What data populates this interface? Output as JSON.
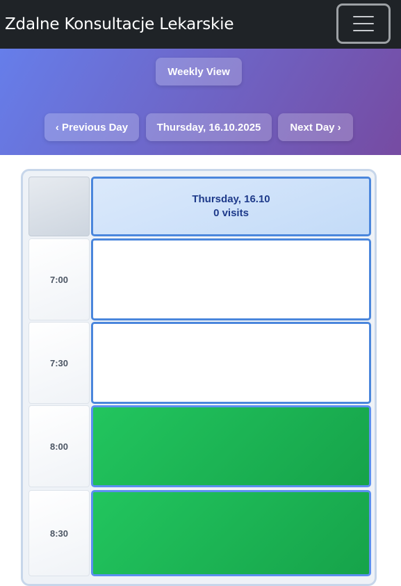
{
  "navbar": {
    "brand": "Zdalne Konsultacje Lekarskie"
  },
  "toolbar": {
    "weekly_view": "Weekly View",
    "previous_day": "‹ Previous Day",
    "current_date": "Thursday, 16.10.2025",
    "next_day": "Next Day ›"
  },
  "calendar": {
    "header": {
      "day": "Thursday, 16.10",
      "visits": "0 visits"
    },
    "slots": [
      {
        "time": "7:00",
        "status": "empty"
      },
      {
        "time": "7:30",
        "status": "empty"
      },
      {
        "time": "8:00",
        "status": "available"
      },
      {
        "time": "8:30",
        "status": "available"
      }
    ]
  },
  "colors": {
    "navbar": "#1f2327",
    "hero_gradient_start": "#667eea",
    "hero_gradient_end": "#764ba2",
    "slot_border": "#4a86dc",
    "available_slot": "#22c55e"
  }
}
